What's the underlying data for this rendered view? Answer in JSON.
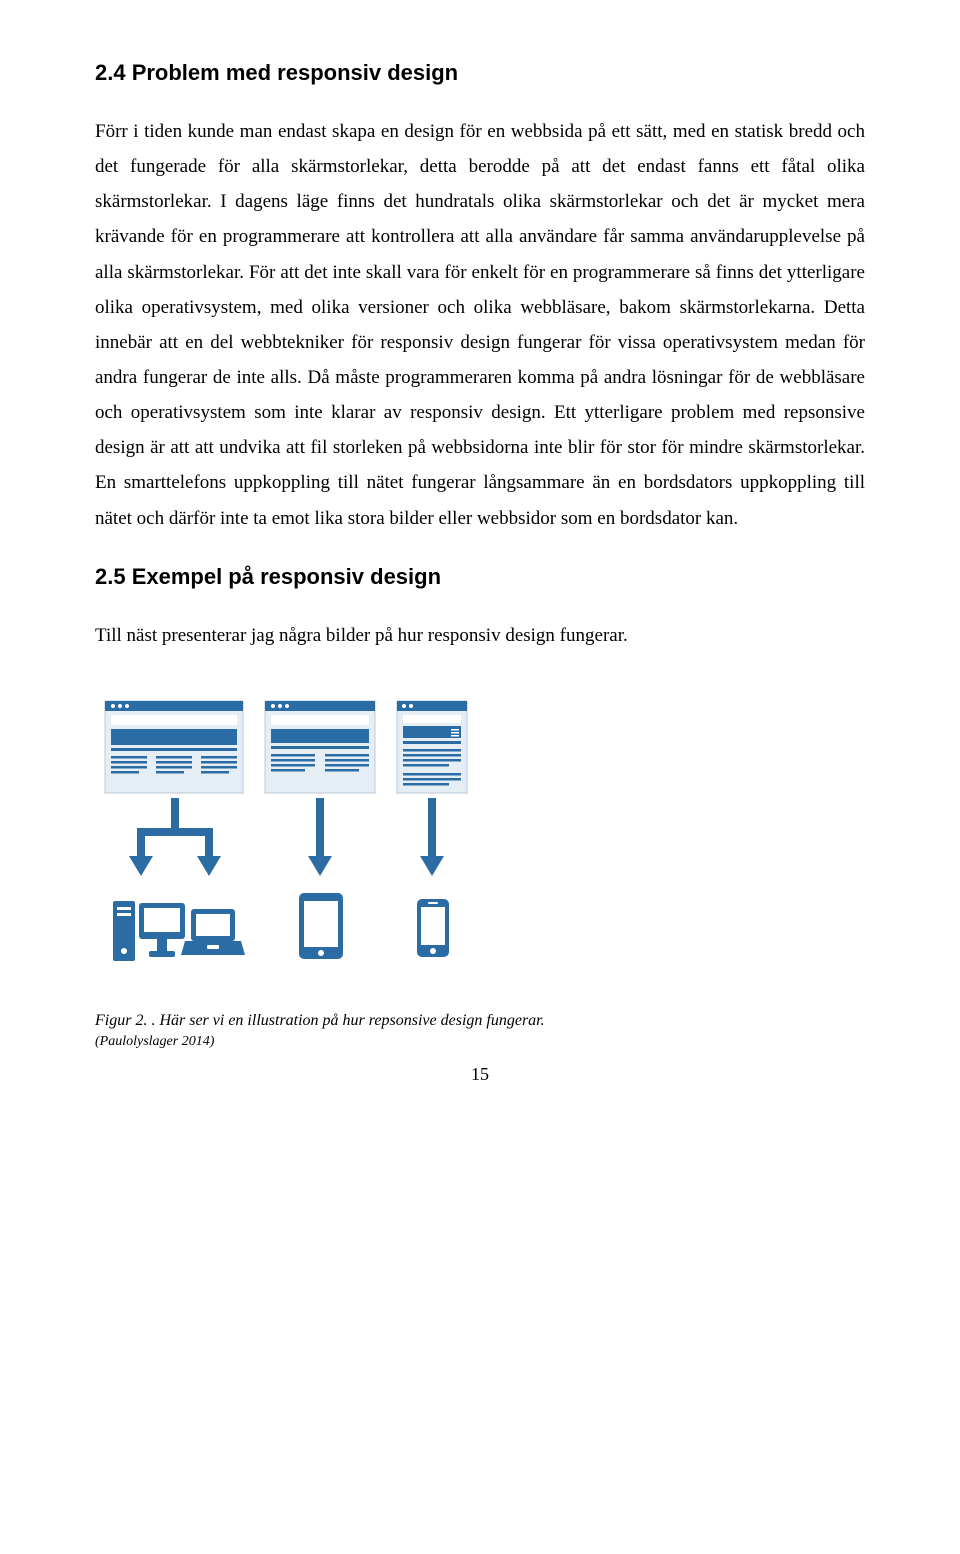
{
  "section24": {
    "heading": "2.4  Problem med responsiv design",
    "paragraph": "Förr i tiden kunde man endast skapa en design för en webbsida på ett sätt, med en statisk bredd och det fungerade för alla skärmstorlekar, detta berodde på att det endast fanns ett fåtal olika skärmstorlekar. I dagens läge finns det hundratals olika skärmstorlekar och det är mycket mera krävande för en programmerare att kontrollera att alla användare får samma användarupplevelse på alla skärmstorlekar. För att det inte skall vara för enkelt för en programmerare så finns det ytterligare olika operativsystem, med olika versioner och olika webbläsare, bakom skärmstorlekarna. Detta innebär att en del webbtekniker för responsiv design fungerar för vissa operativsystem medan för andra fungerar de inte alls. Då måste programmeraren komma på andra lösningar för de webbläsare och operativsystem som inte klarar av responsiv design. Ett ytterligare problem med repsonsive design är att att undvika att fil storleken på webbsidorna inte blir för stor för mindre skärmstorlekar. En smarttelefons uppkoppling till nätet fungerar långsammare än en bordsdators uppkoppling till nätet och därför inte ta emot lika stora bilder eller webbsidor som en bordsdator kan."
  },
  "section25": {
    "heading": "2.5  Exempel på responsiv design",
    "intro": "Till näst presenterar jag några bilder på hur responsiv design fungerar."
  },
  "figure": {
    "caption": "Figur 2. . Här ser vi en illustration på hur repsonsive design fungerar.",
    "source": "(Paulolyslager 2014)"
  },
  "pageNumber": "15",
  "colors": {
    "brandBlue": "#2C6CA4",
    "paleBlue": "#E6EEF5"
  }
}
